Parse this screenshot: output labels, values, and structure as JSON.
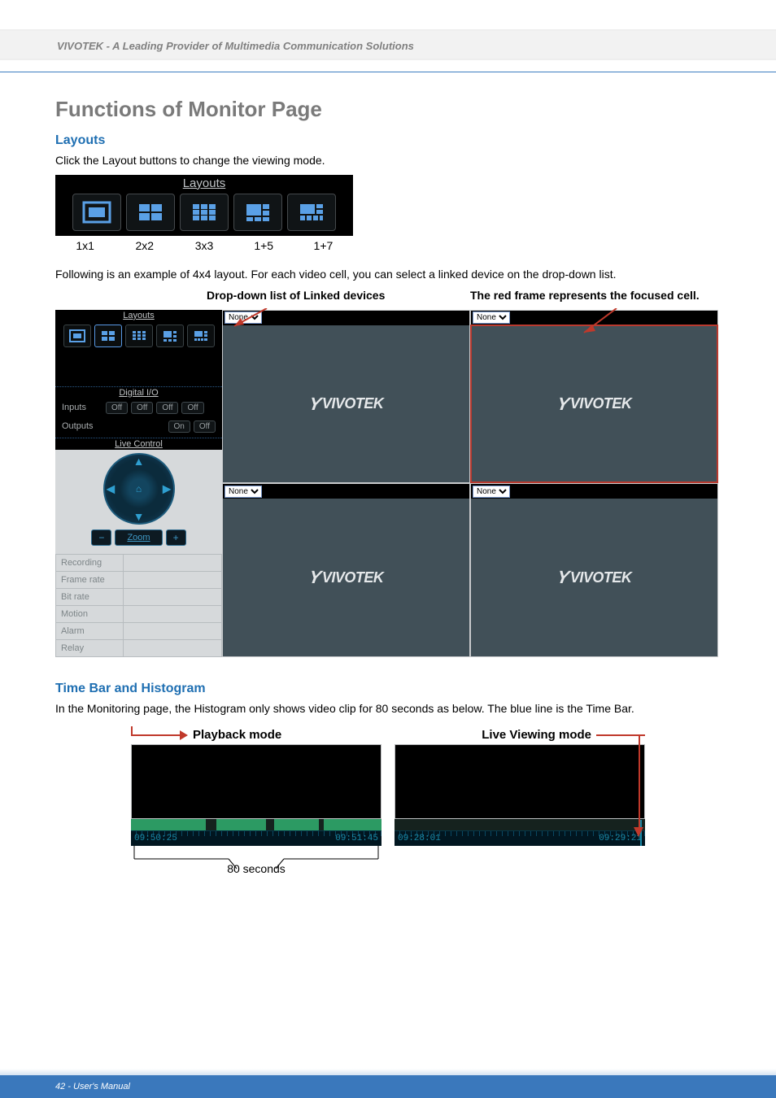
{
  "header": {
    "text": "VIVOTEK - A Leading Provider of Multimedia Communication Solutions"
  },
  "section": {
    "title": "Functions of Monitor Page"
  },
  "layouts": {
    "heading": "Layouts",
    "intro": "Click the Layout buttons to change the viewing mode.",
    "bar_title": "Layouts",
    "labels": [
      "1x1",
      "2x2",
      "3x3",
      "1+5",
      "1+7"
    ]
  },
  "example": {
    "intro": "Following is an example of 4x4 layout. For each video cell, you can select a linked device on the drop-down list.",
    "caption_left": "Drop-down list of Linked devices",
    "caption_right": "The red frame represents the focused cell.",
    "dropdown_value": "None",
    "logo_text": "VIVOTEK"
  },
  "sidepanel": {
    "layouts_title": "Layouts",
    "digital_io_title": "Digital I/O",
    "inputs_label": "Inputs",
    "outputs_label": "Outputs",
    "off": "Off",
    "on": "On",
    "live_control_title": "Live Control",
    "zoom": "Zoom",
    "minus": "−",
    "plus": "+",
    "status": [
      "Recording",
      "Frame rate",
      "Bit rate",
      "Motion",
      "Alarm",
      "Relay"
    ]
  },
  "timebar": {
    "heading": "Time Bar and Histogram",
    "intro": "In the Monitoring page, the Histogram only shows video clip for 80 seconds as below. The blue line is the Time Bar.",
    "playback_label": "Playback mode",
    "live_label": "Live Viewing mode",
    "playback": {
      "start": "09:50:25",
      "end": "09:51:45"
    },
    "live": {
      "start": "09:28:01",
      "end": "09:29:21"
    },
    "span_label": "80 seconds"
  },
  "footer": {
    "text": "42 - User's Manual"
  }
}
